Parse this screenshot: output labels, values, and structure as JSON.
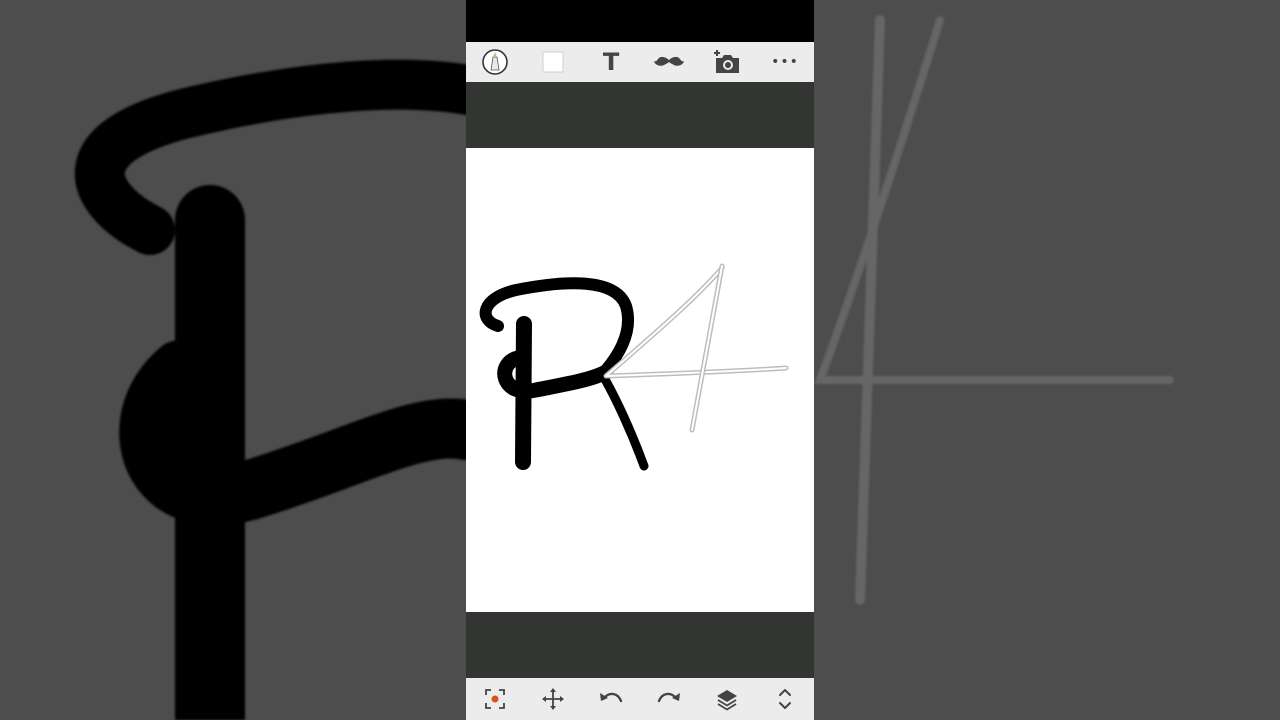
{
  "app": {
    "accent_color": "#d9501c",
    "toolbar_bg": "#ececec",
    "canvas_bg": "#ffffff",
    "workspace_bg": "#333532"
  },
  "top_toolbar": {
    "items": [
      {
        "id": "brush",
        "icon": "brush-color-icon"
      },
      {
        "id": "color",
        "icon": "color-swatch-icon"
      },
      {
        "id": "text",
        "icon": "text-tool-icon",
        "label": "T"
      },
      {
        "id": "mustache",
        "icon": "mustache-sticker-icon"
      },
      {
        "id": "camera",
        "icon": "add-photo-icon"
      },
      {
        "id": "more",
        "icon": "more-icon",
        "label": "•••"
      }
    ]
  },
  "bottom_toolbar": {
    "items": [
      {
        "id": "selection",
        "icon": "selection-icon"
      },
      {
        "id": "move",
        "icon": "move-icon"
      },
      {
        "id": "undo",
        "icon": "undo-icon"
      },
      {
        "id": "redo",
        "icon": "redo-icon"
      },
      {
        "id": "layers",
        "icon": "layers-icon"
      },
      {
        "id": "expand",
        "icon": "expand-icon"
      }
    ]
  },
  "drawing": {
    "stroke_primary": "#000000",
    "stroke_secondary": "#9a9a9a"
  }
}
